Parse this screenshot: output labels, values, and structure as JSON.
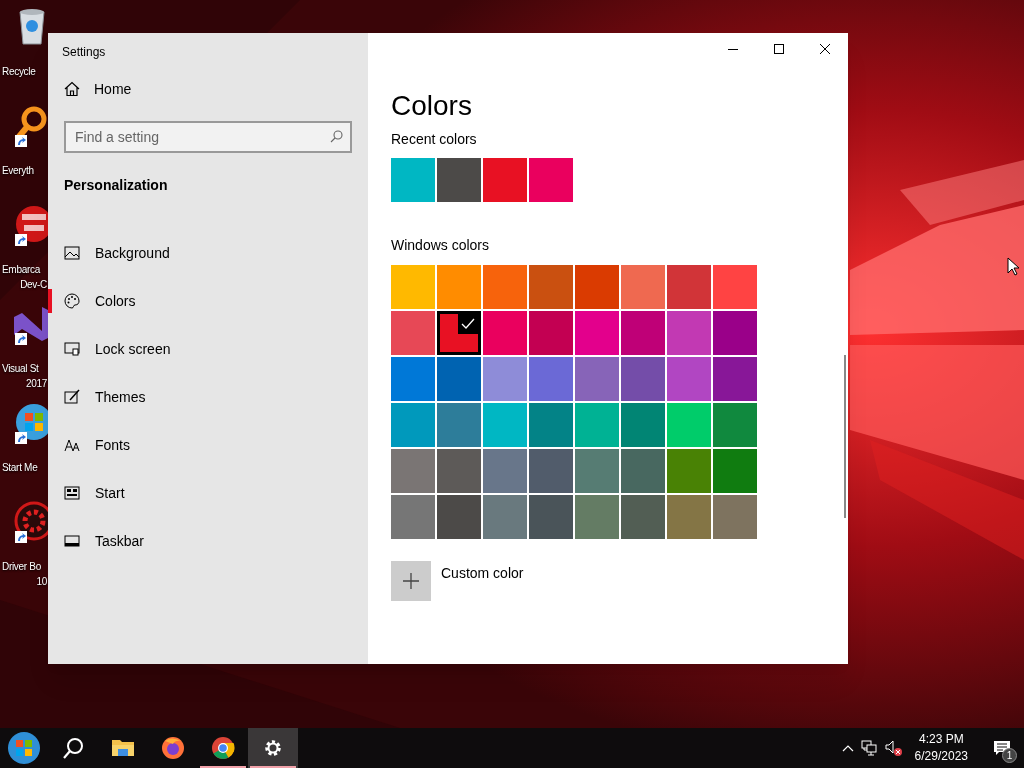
{
  "desktop_icons": [
    {
      "kind": "recycle",
      "shortcut": false,
      "lines": [
        "Recycle"
      ]
    },
    {
      "kind": "magnifier",
      "shortcut": true,
      "lines": [
        "Everyth"
      ]
    },
    {
      "kind": "dev",
      "shortcut": true,
      "lines": [
        "Embarca",
        "Dev-C"
      ]
    },
    {
      "kind": "studio",
      "shortcut": true,
      "lines": [
        "Visual St",
        "2017"
      ]
    },
    {
      "kind": "orb",
      "shortcut": true,
      "lines": [
        "Start Me"
      ]
    },
    {
      "kind": "gear",
      "shortcut": true,
      "lines": [
        "Driver Bo",
        "10"
      ]
    }
  ],
  "window": {
    "title": "Settings"
  },
  "sidebar": {
    "home": "Home",
    "search": {
      "placeholder": "Find a setting"
    },
    "section": "Personalization",
    "items": [
      {
        "kind": "background",
        "label": "Background",
        "selected": false
      },
      {
        "kind": "palette",
        "label": "Colors",
        "selected": true
      },
      {
        "kind": "lock",
        "label": "Lock screen",
        "selected": false
      },
      {
        "kind": "brush",
        "label": "Themes",
        "selected": false
      },
      {
        "kind": "font",
        "label": "Fonts",
        "selected": false
      },
      {
        "kind": "start",
        "label": "Start",
        "selected": false
      },
      {
        "kind": "taskbar",
        "label": "Taskbar",
        "selected": false
      }
    ]
  },
  "content": {
    "title": "Colors",
    "recent": {
      "label": "Recent colors",
      "swatches": [
        {
          "color": "#00b7c3"
        },
        {
          "color": "#4c4a48"
        },
        {
          "color": "#e81123"
        },
        {
          "color": "#ea005e"
        }
      ]
    },
    "windows_colors": {
      "label": "Windows colors",
      "swatches": [
        {
          "color": "#ffb900",
          "selected": false
        },
        {
          "color": "#ff8c00",
          "selected": false
        },
        {
          "color": "#f7630c",
          "selected": false
        },
        {
          "color": "#ca5010",
          "selected": false
        },
        {
          "color": "#da3b01",
          "selected": false
        },
        {
          "color": "#ef6950",
          "selected": false
        },
        {
          "color": "#d13438",
          "selected": false
        },
        {
          "color": "#ff4343",
          "selected": false
        },
        {
          "color": "#e74856",
          "selected": false
        },
        {
          "color": "#e81123",
          "selected": true
        },
        {
          "color": "#ea005e",
          "selected": false
        },
        {
          "color": "#c30052",
          "selected": false
        },
        {
          "color": "#e3008c",
          "selected": false
        },
        {
          "color": "#bf0077",
          "selected": false
        },
        {
          "color": "#c239b3",
          "selected": false
        },
        {
          "color": "#9a0089",
          "selected": false
        },
        {
          "color": "#0078d7",
          "selected": false
        },
        {
          "color": "#0063b1",
          "selected": false
        },
        {
          "color": "#8e8cd8",
          "selected": false
        },
        {
          "color": "#6b69d6",
          "selected": false
        },
        {
          "color": "#8764b8",
          "selected": false
        },
        {
          "color": "#744da9",
          "selected": false
        },
        {
          "color": "#b146c2",
          "selected": false
        },
        {
          "color": "#881798",
          "selected": false
        },
        {
          "color": "#0099bc",
          "selected": false
        },
        {
          "color": "#2d7d9a",
          "selected": false
        },
        {
          "color": "#00b7c3",
          "selected": false
        },
        {
          "color": "#038387",
          "selected": false
        },
        {
          "color": "#00b294",
          "selected": false
        },
        {
          "color": "#018574",
          "selected": false
        },
        {
          "color": "#00cc6a",
          "selected": false
        },
        {
          "color": "#10893e",
          "selected": false
        },
        {
          "color": "#7a7574",
          "selected": false
        },
        {
          "color": "#5d5a58",
          "selected": false
        },
        {
          "color": "#68768a",
          "selected": false
        },
        {
          "color": "#515c6b",
          "selected": false
        },
        {
          "color": "#567c73",
          "selected": false
        },
        {
          "color": "#486860",
          "selected": false
        },
        {
          "color": "#498205",
          "selected": false
        },
        {
          "color": "#107c10",
          "selected": false
        },
        {
          "color": "#767676",
          "selected": false
        },
        {
          "color": "#4c4a48",
          "selected": false
        },
        {
          "color": "#69797e",
          "selected": false
        },
        {
          "color": "#4a5459",
          "selected": false
        },
        {
          "color": "#647c64",
          "selected": false
        },
        {
          "color": "#525e54",
          "selected": false
        },
        {
          "color": "#847545",
          "selected": false
        },
        {
          "color": "#7e735f",
          "selected": false
        }
      ]
    },
    "custom_color": "Custom color"
  },
  "taskbar": {
    "apps": [
      {
        "kind": "start",
        "running": false,
        "selected": false
      },
      {
        "kind": "search",
        "running": false,
        "selected": false
      },
      {
        "kind": "explorer",
        "running": false,
        "selected": false
      },
      {
        "kind": "firefox",
        "running": false,
        "selected": false
      },
      {
        "kind": "chrome",
        "running": true,
        "selected": false
      },
      {
        "kind": "settings",
        "running": true,
        "selected": true
      }
    ],
    "tray": {
      "volume_muted": true,
      "time": "4:23 PM",
      "date": "6/29/2023",
      "notifications": "1"
    }
  }
}
